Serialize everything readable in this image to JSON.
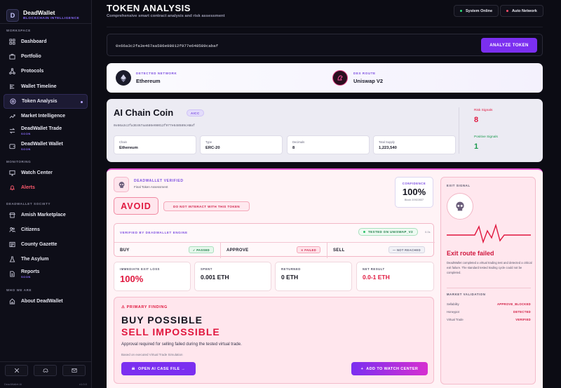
{
  "brand": {
    "name": "DeadWallet",
    "subtitle": "BLOCKCHAIN INTELLIGENCE",
    "logo_letter": "D"
  },
  "sidebar": {
    "sections": {
      "workspace": "WORKSPACE",
      "monitoring": "MONITORING",
      "society": "DEADWALLET SOCIETY",
      "who": "WHO WE ARE"
    },
    "items": [
      {
        "label": "Dashboard",
        "icon": "grid-icon"
      },
      {
        "label": "Portfolio",
        "icon": "briefcase-icon"
      },
      {
        "label": "Protocols",
        "icon": "nodes-icon"
      },
      {
        "label": "Wallet Timeline",
        "icon": "timeline-icon"
      },
      {
        "label": "Token Analysis",
        "icon": "target-icon",
        "active": true
      },
      {
        "label": "Market Intelligence",
        "icon": "trend-icon"
      },
      {
        "label": "DeadWallet Trade",
        "sub": "SOON",
        "icon": "exchange-icon"
      },
      {
        "label": "DeadWallet Wallet",
        "sub": "SOON",
        "icon": "wallet-icon"
      },
      {
        "label": "Watch Center",
        "icon": "monitor-icon"
      },
      {
        "label": "Alerts",
        "icon": "bell-icon"
      },
      {
        "label": "Amish Marketplace",
        "icon": "store-icon"
      },
      {
        "label": "Citizens",
        "icon": "users-icon"
      },
      {
        "label": "County Gazette",
        "icon": "newspaper-icon"
      },
      {
        "label": "The Asylum",
        "icon": "flask-icon"
      },
      {
        "label": "Reports",
        "sub": "SOON",
        "icon": "report-icon"
      },
      {
        "label": "About DeadWallet",
        "icon": "info-icon"
      }
    ],
    "footer": {
      "left": "DeadWallet AI",
      "right": "v1.0.0"
    }
  },
  "header": {
    "title": "TOKEN ANALYSIS",
    "subtitle": "Comprehensive smart contract analysis and risk assessment",
    "status_label": "System Online",
    "network_label": "Auto Network"
  },
  "search": {
    "value": "0x66a3c2fa3e467aa586e98012f977e648589cabaf",
    "placeholder": "Enter token contract address",
    "button": "ANALYZE TOKEN"
  },
  "network": {
    "detected_label": "DETECTED NETWORK",
    "detected_value": "Ethereum",
    "dex_label": "DEX ROUTE",
    "dex_value": "Uniswap V2"
  },
  "token": {
    "name": "AI Chain Coin",
    "symbol": "AICC",
    "address": "0x66a3c2fa3E467aa586e98012f977e648589cABaf",
    "info": [
      {
        "label": "Chain",
        "value": "Ethereum"
      },
      {
        "label": "Type",
        "value": "ERC-20"
      },
      {
        "label": "Decimals",
        "value": "8"
      },
      {
        "label": "Total Supply",
        "value": "1,223,540"
      }
    ],
    "risk_label": "Risk Signals",
    "risk_value": "8",
    "positive_label": "Positive Signals",
    "positive_value": "1"
  },
  "assessment": {
    "verified_label": "DEADWALLET VERIFIED",
    "final_label": "Final Token Assessment",
    "verdict": "AVOID",
    "warning": "DO NOT INTERACT WITH THIS TOKEN",
    "confidence_label": "CONFIDENCE",
    "confidence_value": "100%",
    "confidence_note": "Block 20922837",
    "engine_label": "VERIFIED BY DEADWALLET ENGINE",
    "tested_badge": "TESTED ON UNISWAP_V2",
    "tested_extra": "0.0s",
    "trades": [
      {
        "name": "BUY",
        "status": "✓ PASSED",
        "kind": "pass"
      },
      {
        "name": "APPROVE",
        "status": "✕ FAILED",
        "kind": "fail"
      },
      {
        "name": "SELL",
        "status": "— NOT REACHED",
        "kind": "none"
      }
    ],
    "metrics": [
      {
        "label": "IMMEDIATE EXIT LOSS",
        "value": "100%",
        "kind": "red-big"
      },
      {
        "label": "SPENT",
        "value": "0.001 ETH",
        "kind": "dark"
      },
      {
        "label": "RETURNED",
        "value": "0 ETH",
        "kind": "dark"
      },
      {
        "label": "NET RESULT",
        "value": "0.0-1 ETH",
        "kind": "red"
      }
    ],
    "finding": {
      "label": "⚠ PRIMARY FINDING",
      "line1": "BUY POSSIBLE",
      "line2": "SELL IMPOSSIBLE",
      "desc": "Approval required for selling failed during the tested virtual trade.",
      "note": "Based on executed Virtual Trade Simulation",
      "btn_case": "OPEN AI CASE FILE →",
      "btn_watch": "ADD TO WATCH CENTER"
    },
    "exit": {
      "label": "EXIT SIGNAL",
      "title": "Exit route failed",
      "desc": "DeadWallet completed a virtual trading test and detected a critical exit failure. The standard tested trading cycle could not be completed.",
      "mv_label": "MARKET VALIDATION",
      "rows": [
        {
          "k": "Sellability",
          "v": "APPROVE_BLOCKED"
        },
        {
          "k": "Honeypot",
          "v": "DETECTED"
        },
        {
          "k": "Virtual Trade",
          "v": "VERIFIED"
        }
      ]
    }
  },
  "colors": {
    "accent": "#7b2ff0",
    "danger": "#e0173e",
    "success": "#1b7d45",
    "surface": "#0c0c14"
  }
}
